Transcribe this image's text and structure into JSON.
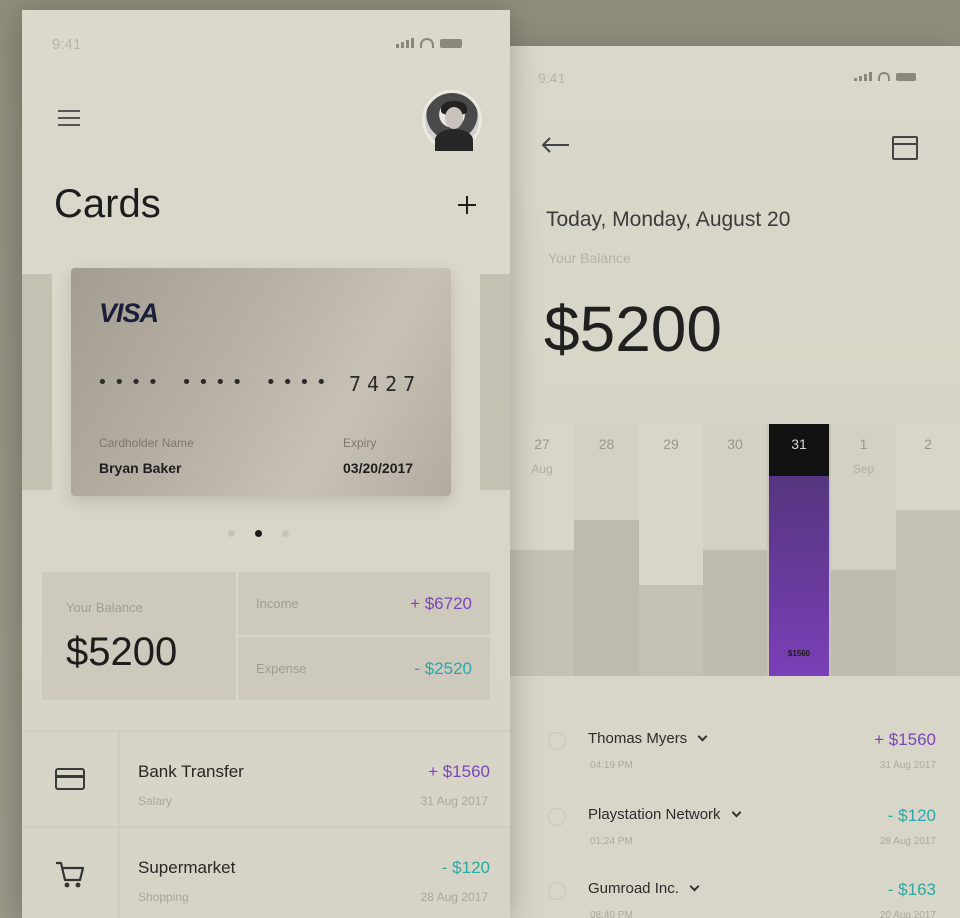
{
  "colors": {
    "accent_purple": "#7d45b9",
    "accent_teal": "#2aa7a9",
    "selected_bar": "#6b3ba3"
  },
  "left": {
    "status_time": "9:41",
    "page_title": "Cards",
    "card": {
      "brand": "VISA",
      "mask": "•••• •••• ••••",
      "last4": "7427",
      "holder_label": "Cardholder Name",
      "holder": "Bryan Baker",
      "expiry_label": "Expiry",
      "expiry": "03/20/2017"
    },
    "carousel": {
      "count": 3,
      "active": 2
    },
    "balance": {
      "label": "Your Balance",
      "amount": "$5200",
      "income_label": "Income",
      "income": "+ $6720",
      "expense_label": "Expense",
      "expense": "- $2520"
    },
    "transactions": [
      {
        "icon": "credit-card-icon",
        "title": "Bank Transfer",
        "sub": "Salary",
        "amount": "+ $1560",
        "date": "31 Aug 2017",
        "tone": "purple"
      },
      {
        "icon": "shopping-cart-icon",
        "title": "Supermarket",
        "sub": "Shopping",
        "amount": "- $120",
        "date": "28 Aug 2017",
        "tone": "teal"
      }
    ]
  },
  "right": {
    "status_time": "9:41",
    "date_line": "Today, Monday, August 20",
    "balance_label": "Your Balance",
    "balance": "$5200",
    "chart_data": {
      "type": "bar",
      "categories": [
        "27",
        "28",
        "29",
        "30",
        "31",
        "1",
        "2"
      ],
      "month_labels": [
        "Aug",
        "",
        "",
        "",
        "",
        "Sep",
        ""
      ],
      "values": [
        0.5,
        0.62,
        0.36,
        0.5,
        0.78,
        0.42,
        0.66
      ],
      "selected_index": 4,
      "selected_value_label": "$1560"
    },
    "transactions": [
      {
        "name": "Thomas Myers",
        "time": "04:19 PM",
        "amount": "+ $1560",
        "date": "31 Aug 2017",
        "tone": "purple"
      },
      {
        "name": "Playstation Network",
        "time": "01:24 PM",
        "amount": "- $120",
        "date": "28 Aug 2017",
        "tone": "teal"
      },
      {
        "name": "Gumroad Inc.",
        "time": "08:40 PM",
        "amount": "- $163",
        "date": "20 Aug 2017",
        "tone": "teal"
      }
    ]
  }
}
